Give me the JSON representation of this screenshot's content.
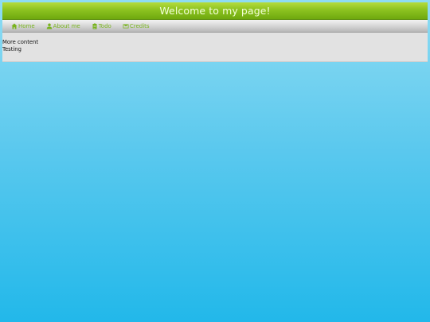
{
  "header": {
    "title": "Welcome to my page!"
  },
  "nav": {
    "items": [
      {
        "label": "Home",
        "icon": "home-icon"
      },
      {
        "label": "About me",
        "icon": "user-icon"
      },
      {
        "label": "Todo",
        "icon": "clipboard-icon"
      },
      {
        "label": "Credits",
        "icon": "envelope-icon"
      }
    ]
  },
  "content": {
    "lines": [
      "More content",
      "Testing"
    ]
  },
  "colors": {
    "banner": "#8cc220",
    "nav_link": "#78b31d",
    "background_top": "#8fdcf3",
    "background_bottom": "#22b8ea"
  }
}
